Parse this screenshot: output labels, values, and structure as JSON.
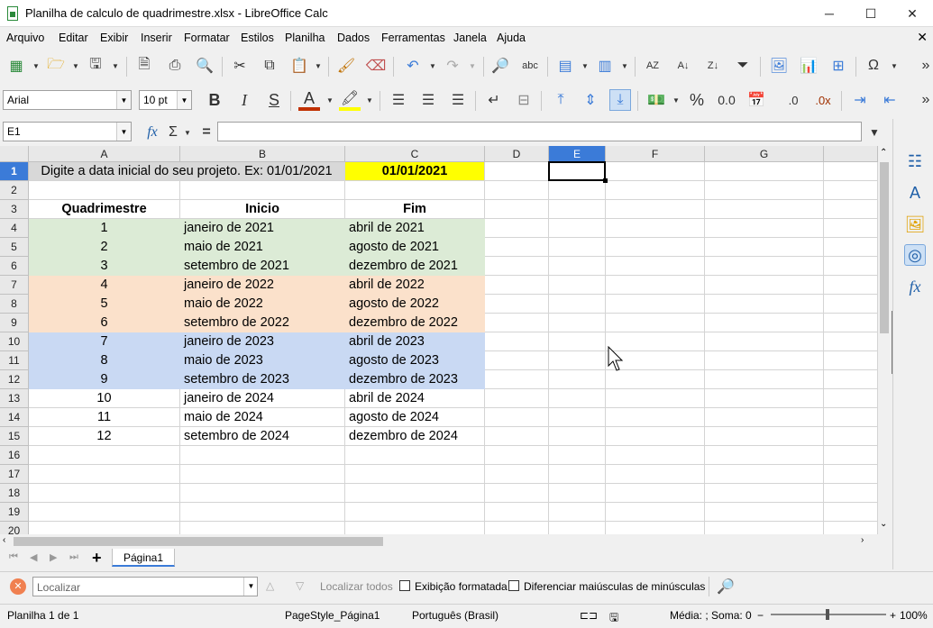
{
  "window": {
    "title": "Planilha de calculo de quadrimestre.xlsx - LibreOffice Calc",
    "minimize": "─",
    "maximize": "☐",
    "close": "✕"
  },
  "menu": [
    "Arquivo",
    "Editar",
    "Exibir",
    "Inserir",
    "Formatar",
    "Estilos",
    "Planilha",
    "Dados",
    "Ferramentas",
    "Janela",
    "Ajuda"
  ],
  "formatting": {
    "font_name": "Arial",
    "font_size": "10 pt"
  },
  "formula_bar": {
    "name_box": "E1",
    "fx": "fx",
    "sigma": "Σ",
    "equals": "=",
    "content": ""
  },
  "columns": [
    "A",
    "B",
    "C",
    "D",
    "E",
    "F",
    "G"
  ],
  "rows": [
    "1",
    "2",
    "3",
    "4",
    "5",
    "6",
    "7",
    "8",
    "9",
    "10",
    "11",
    "12",
    "13",
    "14",
    "15",
    "16",
    "17",
    "18",
    "19",
    "20"
  ],
  "sheet": {
    "A1": "Digite a data inicial do seu projeto. Ex: 01/01/2021",
    "C1": "01/01/2021",
    "headers": {
      "A3": "Quadrimestre",
      "B3": "Inicio",
      "C3": "Fim"
    },
    "table": [
      {
        "n": "1",
        "inicio": "janeiro de 2021",
        "fim": "abril de 2021",
        "band": "green"
      },
      {
        "n": "2",
        "inicio": "maio de 2021",
        "fim": "agosto de 2021",
        "band": "green"
      },
      {
        "n": "3",
        "inicio": "setembro de 2021",
        "fim": "dezembro de 2021",
        "band": "green"
      },
      {
        "n": "4",
        "inicio": "janeiro de 2022",
        "fim": "abril de 2022",
        "band": "orange"
      },
      {
        "n": "5",
        "inicio": "maio de 2022",
        "fim": "agosto de 2022",
        "band": "orange"
      },
      {
        "n": "6",
        "inicio": "setembro de 2022",
        "fim": "dezembro de 2022",
        "band": "orange"
      },
      {
        "n": "7",
        "inicio": "janeiro de 2023",
        "fim": "abril de 2023",
        "band": "blue"
      },
      {
        "n": "8",
        "inicio": "maio de 2023",
        "fim": "agosto de 2023",
        "band": "blue"
      },
      {
        "n": "9",
        "inicio": "setembro de 2023",
        "fim": "dezembro de 2023",
        "band": "blue"
      },
      {
        "n": "10",
        "inicio": "janeiro de 2024",
        "fim": "abril de 2024",
        "band": "none"
      },
      {
        "n": "11",
        "inicio": "maio de 2024",
        "fim": "agosto de 2024",
        "band": "none"
      },
      {
        "n": "12",
        "inicio": "setembro de 2024",
        "fim": "dezembro de 2024",
        "band": "none"
      }
    ]
  },
  "colors": {
    "green": "#dcebd6",
    "orange": "#fbe1cb",
    "blue": "#c9d9f3",
    "yellow": "#ffff00",
    "selected_header": "#3b7bd8"
  },
  "sheet_tabs": {
    "add": "+",
    "active": "Página1"
  },
  "find_bar": {
    "placeholder": "Localizar",
    "find_all": "Localizar todos",
    "formatted_display": "Exibição formatada",
    "match_case": "Diferenciar maiúsculas de minúsculas"
  },
  "status_bar": {
    "sheet": "Planilha 1 de 1",
    "page_style": "PageStyle_Página1",
    "language": "Português (Brasil)",
    "sum": "Média: ; Soma: 0",
    "zoom": "100%"
  }
}
